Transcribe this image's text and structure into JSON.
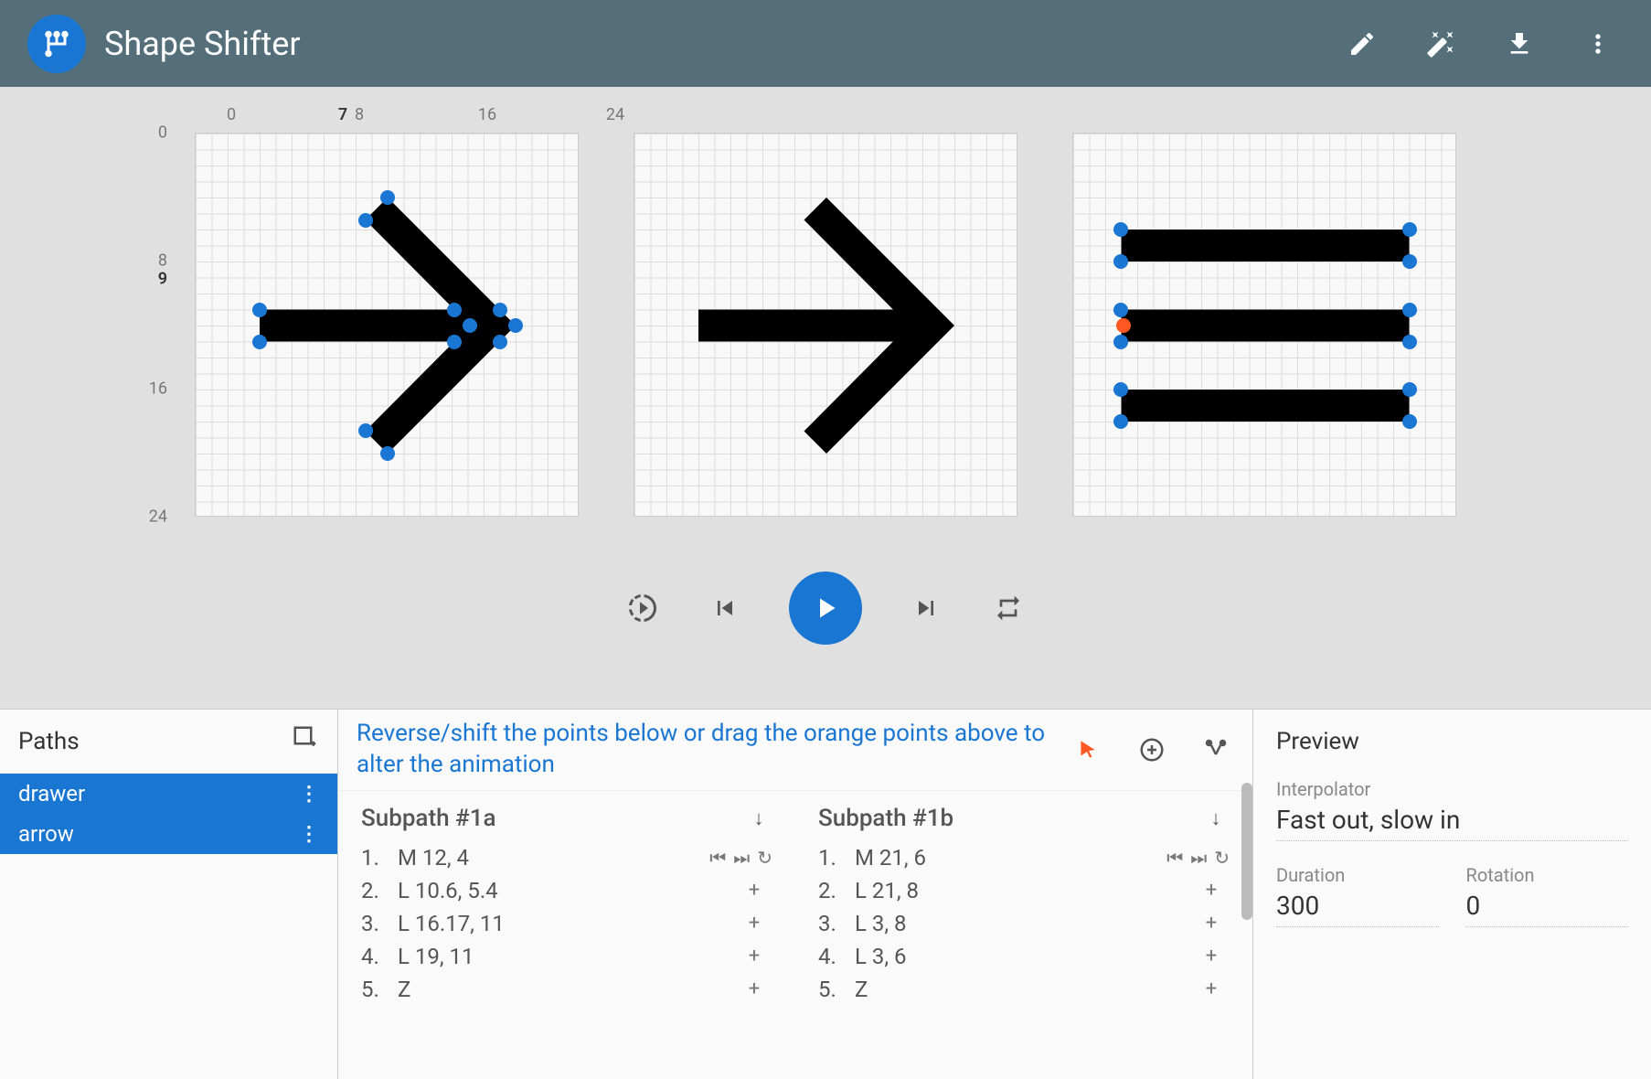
{
  "header": {
    "title": "Shape Shifter",
    "logo_text": "H"
  },
  "ruler": {
    "top": [
      "0",
      "7",
      "8",
      "16",
      "24"
    ],
    "left": [
      "0",
      "8",
      "9",
      "16",
      "24"
    ]
  },
  "paths_panel": {
    "title": "Paths",
    "items": [
      {
        "label": "drawer"
      },
      {
        "label": "arrow"
      }
    ]
  },
  "subpaths": {
    "hint": "Reverse/shift the points below or drag the orange points above to alter the animation",
    "columns": [
      {
        "title": "Subpath #1a",
        "commands": [
          {
            "idx": "1.",
            "text": "M 12, 4",
            "first": true
          },
          {
            "idx": "2.",
            "text": "L 10.6, 5.4"
          },
          {
            "idx": "3.",
            "text": "L 16.17, 11"
          },
          {
            "idx": "4.",
            "text": "L 19, 11"
          },
          {
            "idx": "5.",
            "text": "Z"
          }
        ]
      },
      {
        "title": "Subpath #1b",
        "commands": [
          {
            "idx": "1.",
            "text": "M 21, 6",
            "first": true
          },
          {
            "idx": "2.",
            "text": "L 21, 8"
          },
          {
            "idx": "3.",
            "text": "L 3, 8"
          },
          {
            "idx": "4.",
            "text": "L 3, 6"
          },
          {
            "idx": "5.",
            "text": "Z"
          }
        ]
      }
    ]
  },
  "preview": {
    "title": "Preview",
    "interpolator_label": "Interpolator",
    "interpolator_value": "Fast out, slow in",
    "duration_label": "Duration",
    "duration_value": "300",
    "rotation_label": "Rotation",
    "rotation_value": "0"
  }
}
